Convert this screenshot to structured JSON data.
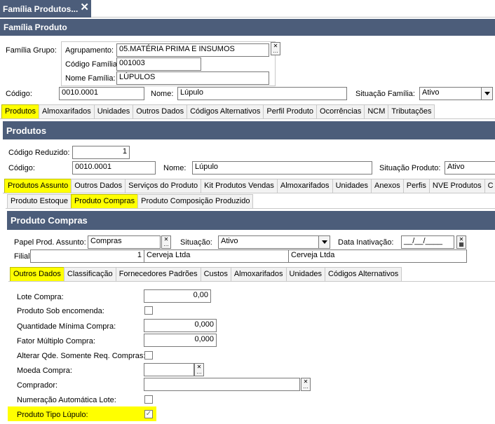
{
  "window": {
    "tab_title": "Família Produtos...",
    "close_glyph": "✕"
  },
  "familia": {
    "header": "Família Produto",
    "grupo_label": "Família Grupo:",
    "agrupamento_label": "Agrupamento:",
    "agrupamento_value": "05.MATÉRIA PRIMA E INSUMOS",
    "codigo_familia_label": "Código Família:",
    "codigo_familia_value": "001003",
    "nome_familia_label": "Nome Família:",
    "nome_familia_value": "LÚPULOS",
    "codigo_label": "Código:",
    "codigo_value": "0010.0001",
    "nome_label": "Nome:",
    "nome_value": "Lúpulo",
    "situacao_label": "Situação Família:",
    "situacao_value": "Ativo"
  },
  "familia_tabs": [
    "Produtos",
    "Almoxarifados",
    "Unidades",
    "Outros Dados",
    "Códigos Alternativos",
    "Perfil Produto",
    "Ocorrências",
    "NCM",
    "Tributações"
  ],
  "produtos": {
    "header": "Produtos",
    "codigo_reduzido_label": "Código Reduzido:",
    "codigo_reduzido_value": "1",
    "codigo_label": "Código:",
    "codigo_value": "0010.0001",
    "nome_label": "Nome:",
    "nome_value": "Lúpulo",
    "situacao_label": "Situação Produto:",
    "situacao_value": "Ativo"
  },
  "produto_tabs": [
    "Produtos Assunto",
    "Outros Dados",
    "Serviços do Produto",
    "Kit Produtos Vendas",
    "Almoxarifados",
    "Unidades",
    "Anexos",
    "Perfis",
    "NVE Produtos",
    "C"
  ],
  "assunto_tabs": [
    "Produto Estoque",
    "Produto Compras",
    "Produto Composição Produzido"
  ],
  "compras": {
    "header": "Produto Compras",
    "papel_label": "Papel Prod. Assunto:",
    "papel_value": "Compras",
    "situacao_label": "Situação:",
    "situacao_value": "Ativo",
    "data_label": "Data Inativação:",
    "data_value": "__/__/____",
    "filial_label": "Filial:",
    "filial_code": "1",
    "filial_name": "Cerveja Ltda",
    "filial_name2": "Cerveja Ltda"
  },
  "compras_tabs": [
    "Outros Dados",
    "Classificação",
    "Fornecedores Padrões",
    "Custos",
    "Almoxarifados",
    "Unidades",
    "Códigos Alternativos"
  ],
  "outros": {
    "lote_compra_label": "Lote Compra:",
    "lote_compra_value": "0,00",
    "sob_encomenda_label": "Produto Sob encomenda:",
    "qtd_minima_label": "Quantidade Mínima Compra:",
    "qtd_minima_value": "0,000",
    "fator_label": "Fator Múltiplo Compra:",
    "fator_value": "0,000",
    "alterar_label": "Alterar Qde. Somente Req. Compras:",
    "moeda_label": "Moeda Compra:",
    "moeda_value": "",
    "comprador_label": "Comprador:",
    "comprador_value": "",
    "numeracao_label": "Numeração Automática Lote:",
    "tipo_lupulo_label": "Produto Tipo Lúpulo:",
    "tipo_lupulo_check": "✓"
  },
  "colors": {
    "header": "#4c5d7a",
    "highlight": "#ffff00"
  }
}
